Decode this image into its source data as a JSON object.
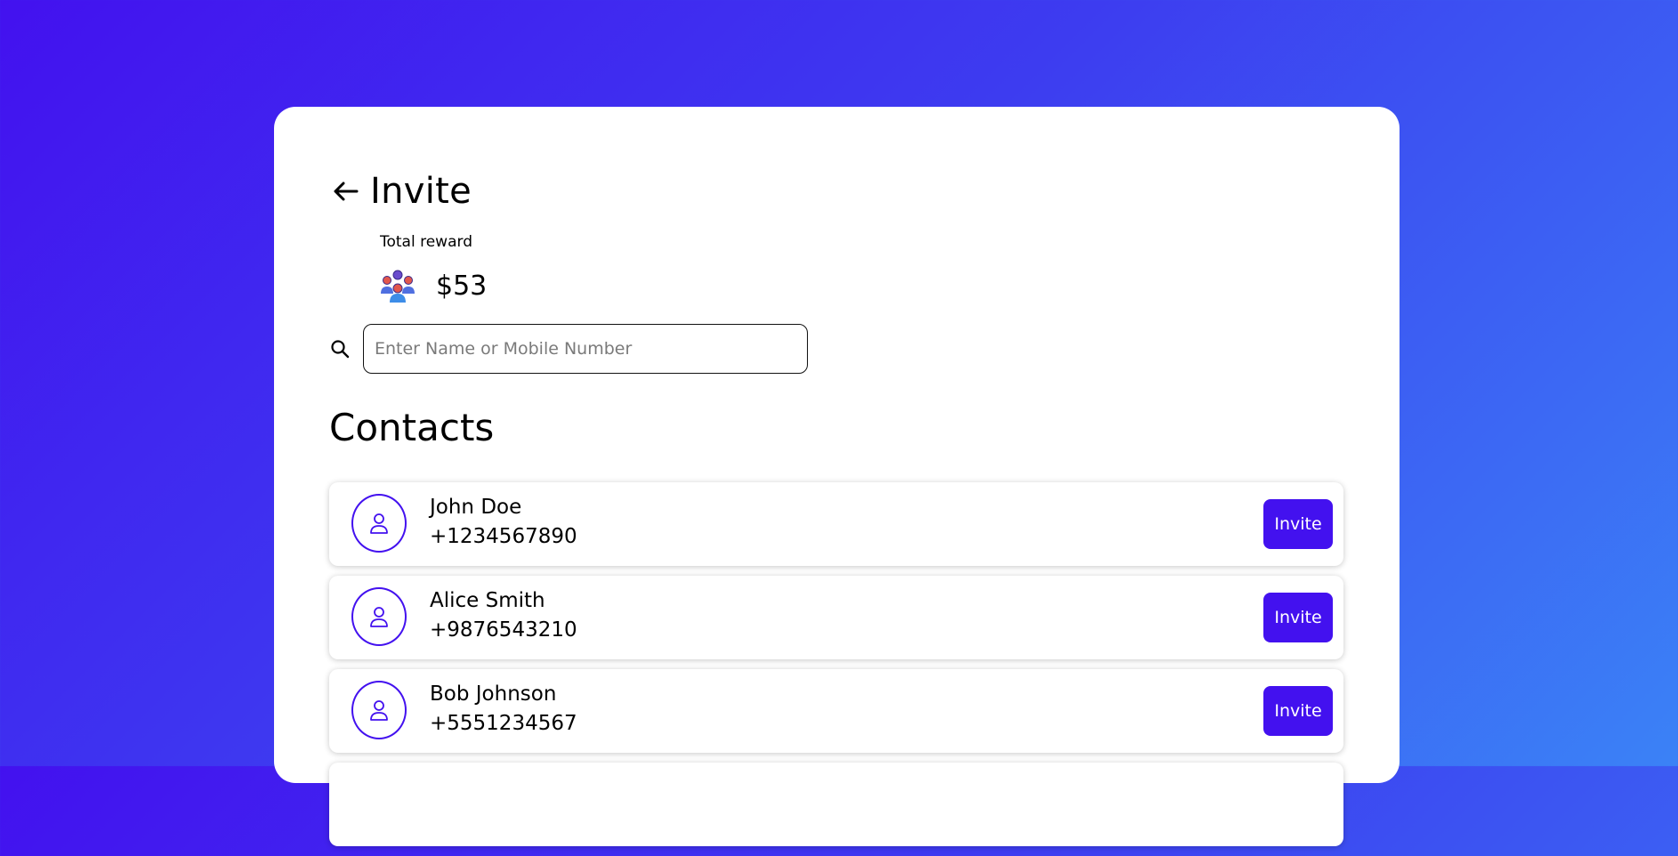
{
  "header": {
    "title": "Invite",
    "back_icon": "arrow-left-icon"
  },
  "reward": {
    "label": "Total reward",
    "value": "$53",
    "icon": "group-icon"
  },
  "search": {
    "placeholder": "Enter Name or Mobile Number",
    "value": "",
    "icon": "search-icon"
  },
  "contacts": {
    "title": "Contacts",
    "items": [
      {
        "name": "John Doe",
        "phone": "+1234567890",
        "action": "Invite"
      },
      {
        "name": "Alice Smith",
        "phone": "+9876543210",
        "action": "Invite"
      },
      {
        "name": "Bob Johnson",
        "phone": "+5551234567",
        "action": "Invite"
      },
      {
        "name": "",
        "phone": "",
        "action": ""
      }
    ]
  },
  "colors": {
    "accent": "#4311ef",
    "background_start": "#4311ef",
    "background_end": "#3b82f6",
    "card": "#ffffff"
  }
}
